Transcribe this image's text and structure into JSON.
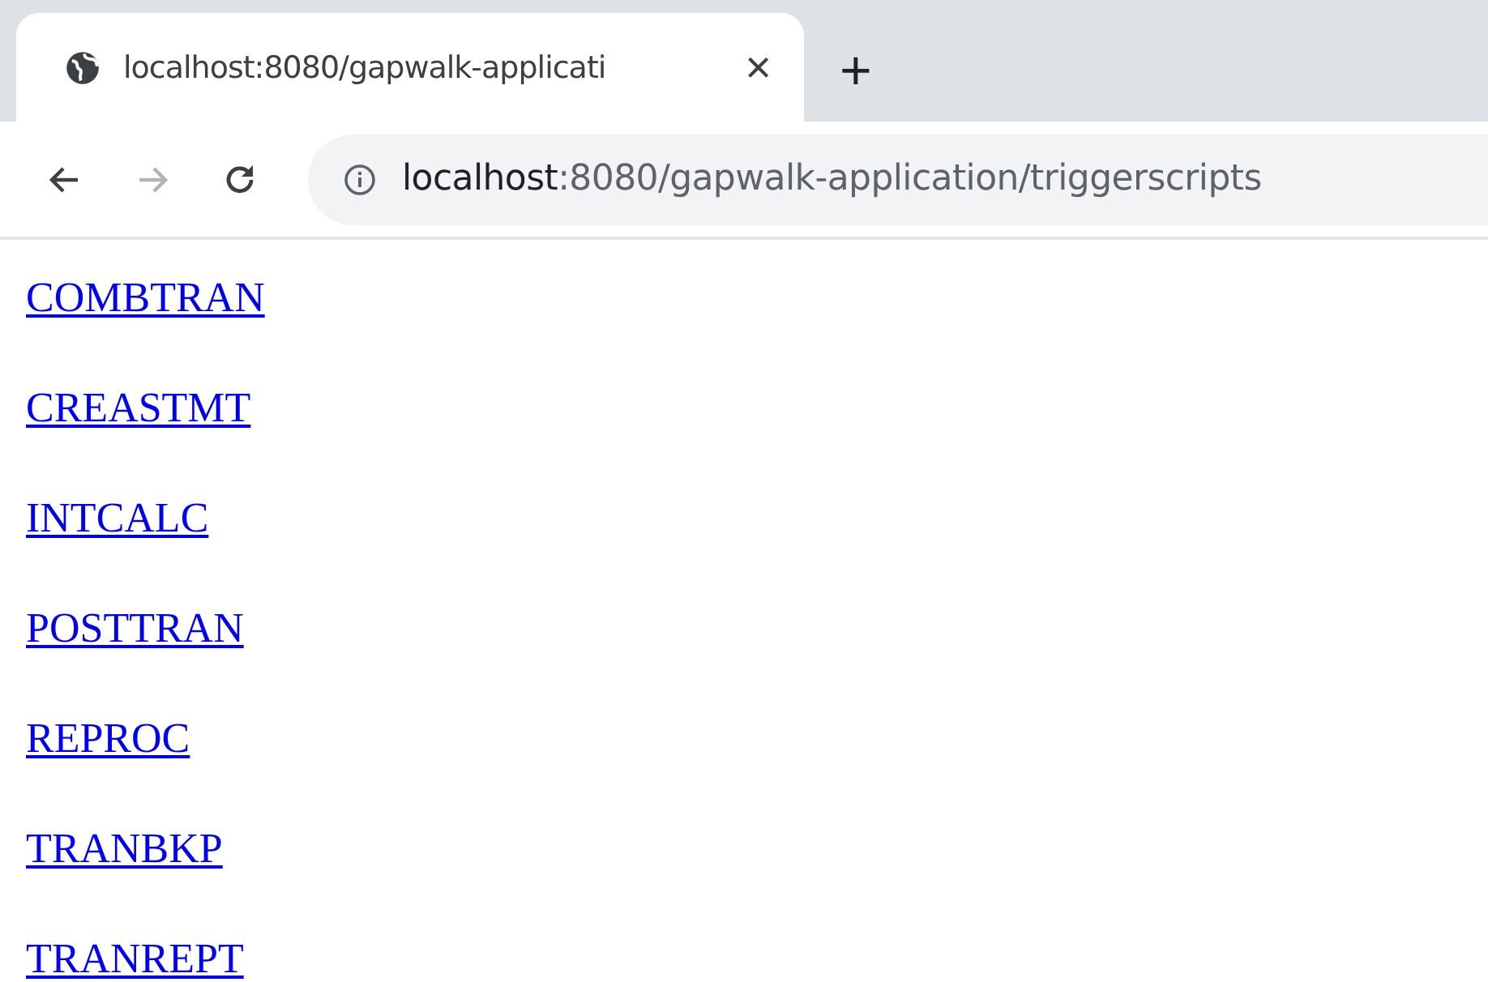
{
  "tab": {
    "title": "localhost:8080/gapwalk-applicati",
    "close": "×",
    "new_tab": "+"
  },
  "toolbar": {
    "buttons": [
      {
        "kind": "back",
        "disabled": false
      },
      {
        "kind": "forward",
        "disabled": true
      },
      {
        "kind": "reload",
        "disabled": false
      }
    ],
    "address": {
      "host": "localhost",
      "path": ":8080/gapwalk-application/triggerscripts"
    }
  },
  "links": [
    "COMBTRAN",
    "CREASTMT",
    "INTCALC",
    "POSTTRAN",
    "REPROC",
    "TRANBKP",
    "TRANREPT"
  ]
}
